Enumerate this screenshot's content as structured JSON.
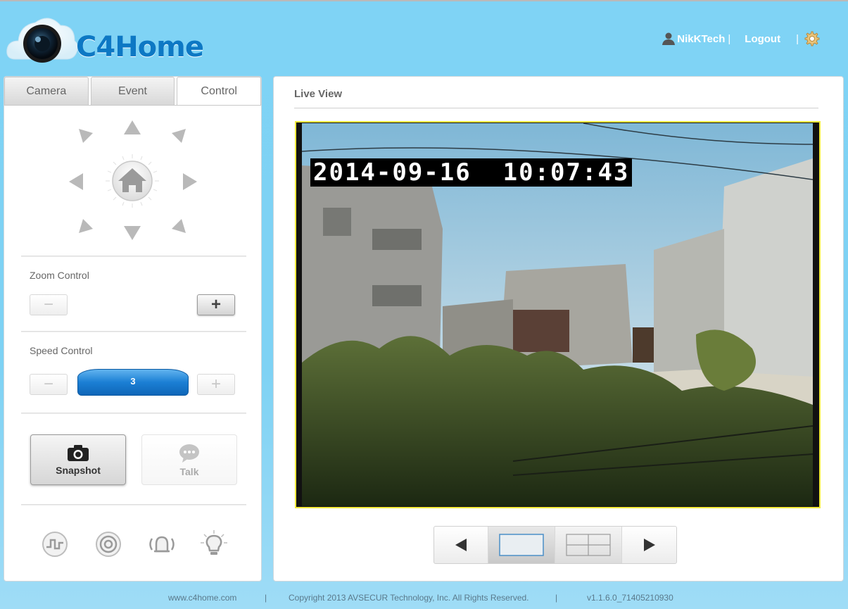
{
  "header": {
    "logo_text": "C4Home",
    "username": "NikKTech",
    "separator": "|",
    "logout_label": "Logout",
    "icons": {
      "user": "user-icon",
      "settings": "gear-icon",
      "logo": "camera-cloud-icon"
    },
    "colors": {
      "background": "#7ed2f4",
      "logo": "#0d78c4"
    }
  },
  "left_panel": {
    "tabs": [
      {
        "label": "Camera",
        "active": false
      },
      {
        "label": "Event",
        "active": false
      },
      {
        "label": "Control",
        "active": true
      }
    ],
    "ptz": {
      "icons": [
        "arrow-up-left-icon",
        "arrow-up-icon",
        "arrow-up-right-icon",
        "arrow-left-icon",
        "home-icon",
        "arrow-right-icon",
        "arrow-down-left-icon",
        "arrow-down-icon",
        "arrow-down-right-icon"
      ]
    },
    "zoom": {
      "label": "Zoom Control",
      "minus": "−",
      "plus": "+"
    },
    "speed": {
      "label": "Speed Control",
      "minus": "−",
      "plus": "+",
      "value": "3",
      "color": "#1b7fd4"
    },
    "actions": {
      "snapshot_label": "Snapshot",
      "talk_label": "Talk",
      "icons": {
        "snapshot": "camera-icon",
        "talk": "speech-bubble-icon"
      }
    },
    "bottom_icons": [
      "io-pulse-icon",
      "target-icon",
      "alarm-bell-icon",
      "light-bulb-icon"
    ]
  },
  "right_panel": {
    "title": "Live View",
    "video": {
      "timestamp": "2014-09-16  10:07:43",
      "frame_color": "#f2ea3a"
    },
    "view_controls": {
      "icons": [
        "prev-triangle-icon",
        "single-view-icon",
        "quad-view-icon",
        "next-triangle-icon"
      ],
      "selected": "single"
    }
  },
  "footer": {
    "site": "www.c4home.com",
    "separator": "|",
    "copyright": "Copyright 2013 AVSECUR Technology, Inc. All Rights Reserved.",
    "version": "v1.1.6.0_71405210930"
  }
}
